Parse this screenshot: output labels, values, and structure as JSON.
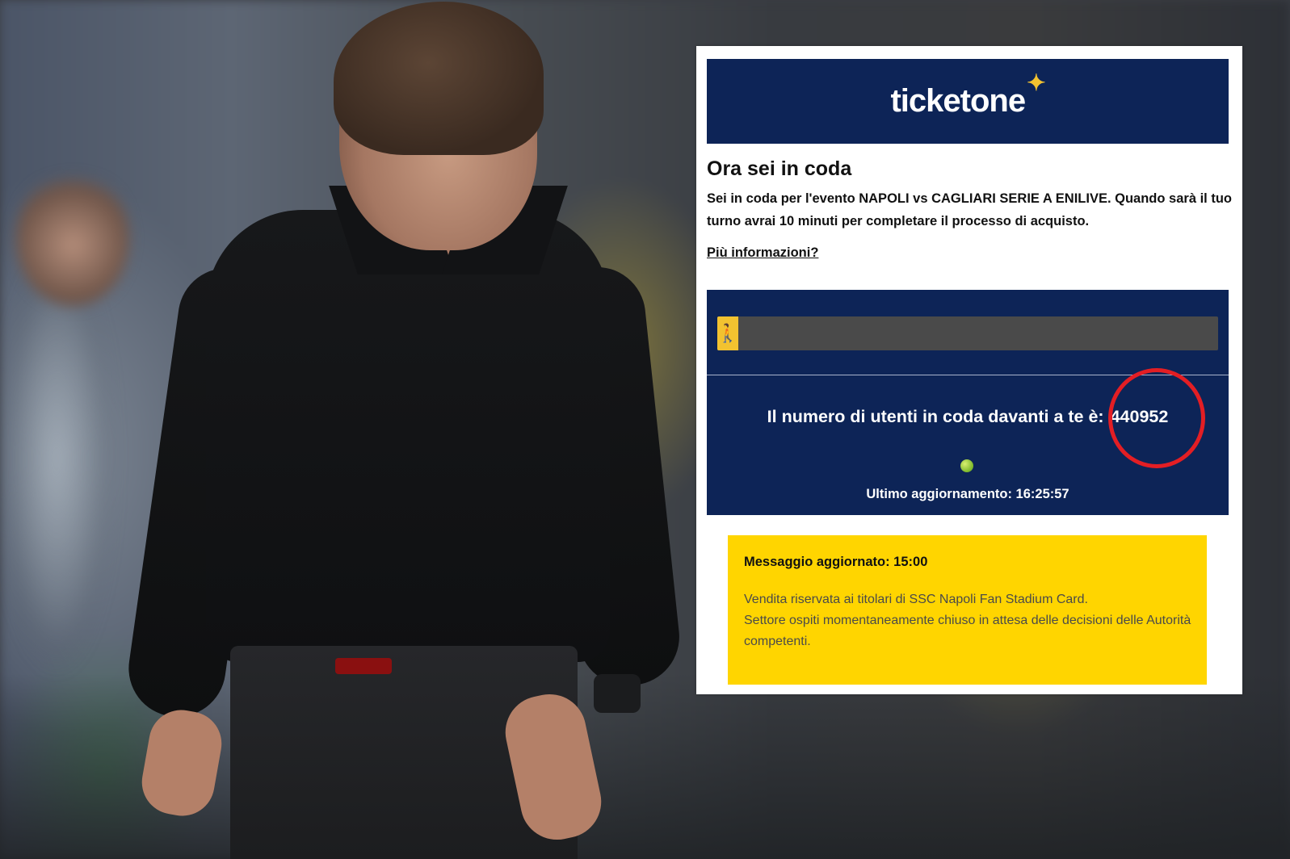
{
  "brand": {
    "logo_text": "ticketone",
    "logo_star_icon": "sparkle-star-icon",
    "header_color": "#0d2457",
    "accent_color": "#f2c230"
  },
  "queue_page": {
    "title": "Ora sei in coda",
    "intro": "Sei in coda per l'evento NAPOLI vs CAGLIARI SERIE A ENILIVE. Quando sarà il tuo turno avrai 10 minuti per completare il processo di acquisto.",
    "more_info_link": "Più informazioni?",
    "progress": {
      "fraction": 0.02,
      "icon": "walking-person-icon"
    },
    "users_ahead_label": "Il numero di utenti in coda davanti a te è:",
    "users_ahead_value": "440952",
    "status_indicator_color": "#8cc63f",
    "last_update": "Ultimo aggiornamento: 16:25:57"
  },
  "notice": {
    "title": "Messaggio aggiornato: 15:00",
    "body_lines": [
      "Vendita riservata ai titolari di SSC Napoli Fan Stadium Card.",
      "Settore ospiti momentaneamente chiuso in attesa delle decisioni delle Autorità competenti."
    ],
    "background_color": "#ffd500"
  },
  "annotation": {
    "highlight_color": "#e31e24"
  }
}
